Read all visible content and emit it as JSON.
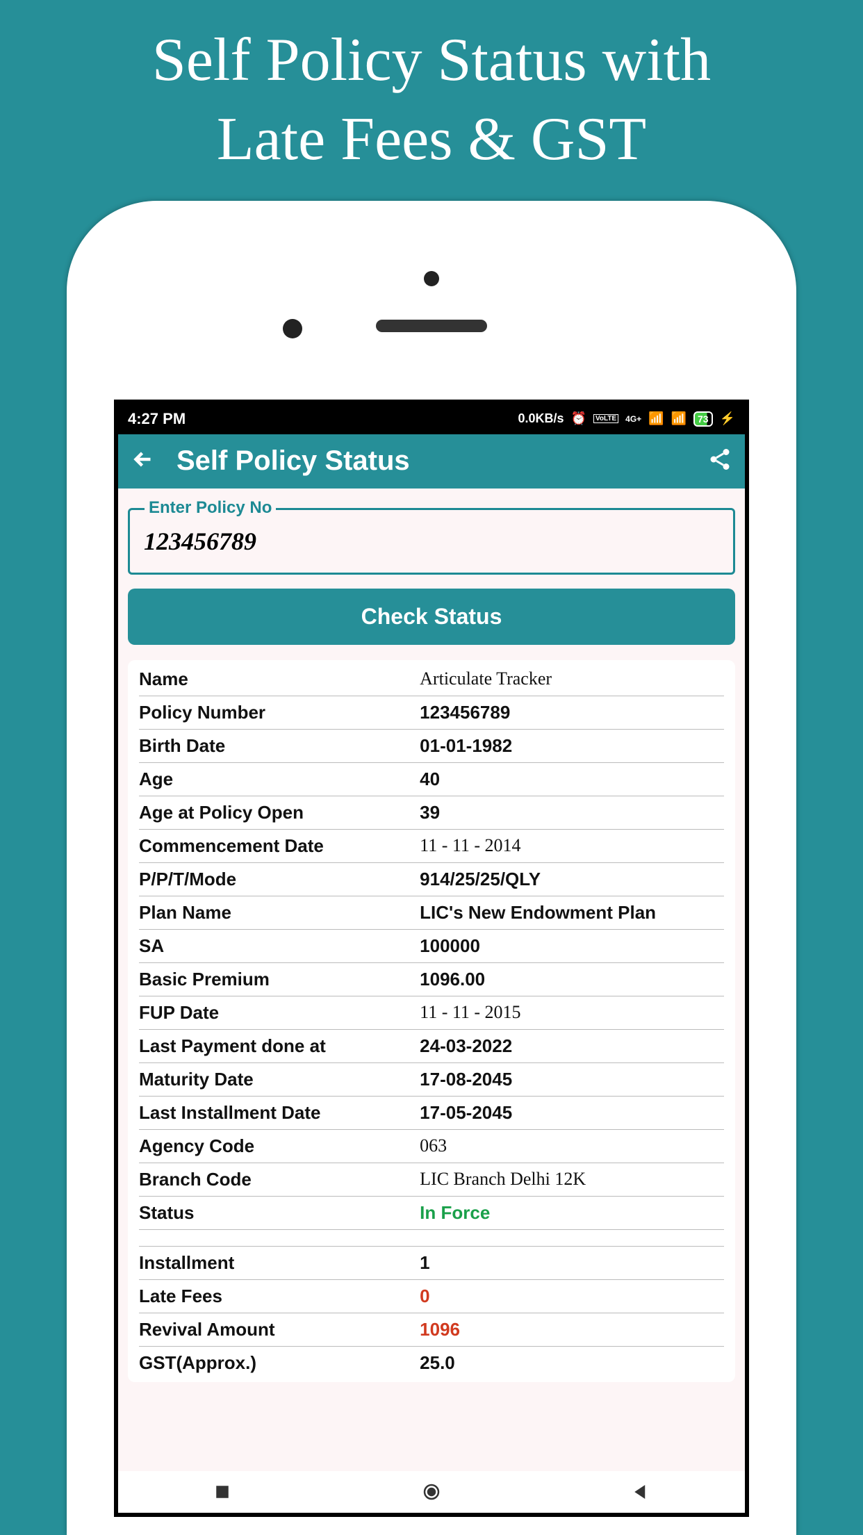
{
  "promo": {
    "line1": "Self Policy Status with",
    "line2": "Late Fees & GST"
  },
  "status_bar": {
    "time": "4:27 PM",
    "speed": "0.0KB/s",
    "net_badge": "VoLTE",
    "net_type": "4G+",
    "battery": "73"
  },
  "app_bar": {
    "title": "Self Policy Status"
  },
  "input": {
    "label": "Enter Policy No",
    "value": "123456789"
  },
  "button": {
    "check_label": "Check Status"
  },
  "details": [
    {
      "label": "Name",
      "value": "Articulate Tracker",
      "style": "cursive"
    },
    {
      "label": "Policy Number",
      "value": "123456789"
    },
    {
      "label": "Birth Date",
      "value": "01-01-1982"
    },
    {
      "label": "Age",
      "value": "40"
    },
    {
      "label": "Age at Policy Open",
      "value": "39"
    },
    {
      "label": "Commencement Date",
      "value": "11 - 11 - 2014",
      "style": "cursive"
    },
    {
      "label": "P/P/T/Mode",
      "value": "914/25/25/QLY"
    },
    {
      "label": "Plan Name",
      "value": "LIC's New Endowment Plan"
    },
    {
      "label": "SA",
      "value": "100000"
    },
    {
      "label": "Basic Premium",
      "value": "1096.00"
    },
    {
      "label": "FUP Date",
      "value": "11 - 11 - 2015",
      "style": "cursive"
    },
    {
      "label": "Last Payment done at",
      "value": "24-03-2022"
    },
    {
      "label": "Maturity Date",
      "value": "17-08-2045"
    },
    {
      "label": "Last Installment Date",
      "value": "17-05-2045"
    },
    {
      "label": "Agency Code",
      "value": "063",
      "style": "cursive"
    },
    {
      "label": "Branch Code",
      "value": "LIC Branch Delhi 12K",
      "style": "cursive"
    },
    {
      "label": "Status",
      "value": "In Force",
      "style": "green"
    }
  ],
  "summary": [
    {
      "label": "Installment",
      "value": "1"
    },
    {
      "label": "Late Fees",
      "value": "0",
      "style": "red"
    },
    {
      "label": "Revival Amount",
      "value": "1096",
      "style": "red"
    },
    {
      "label": "GST(Approx.)",
      "value": "25.0"
    }
  ]
}
